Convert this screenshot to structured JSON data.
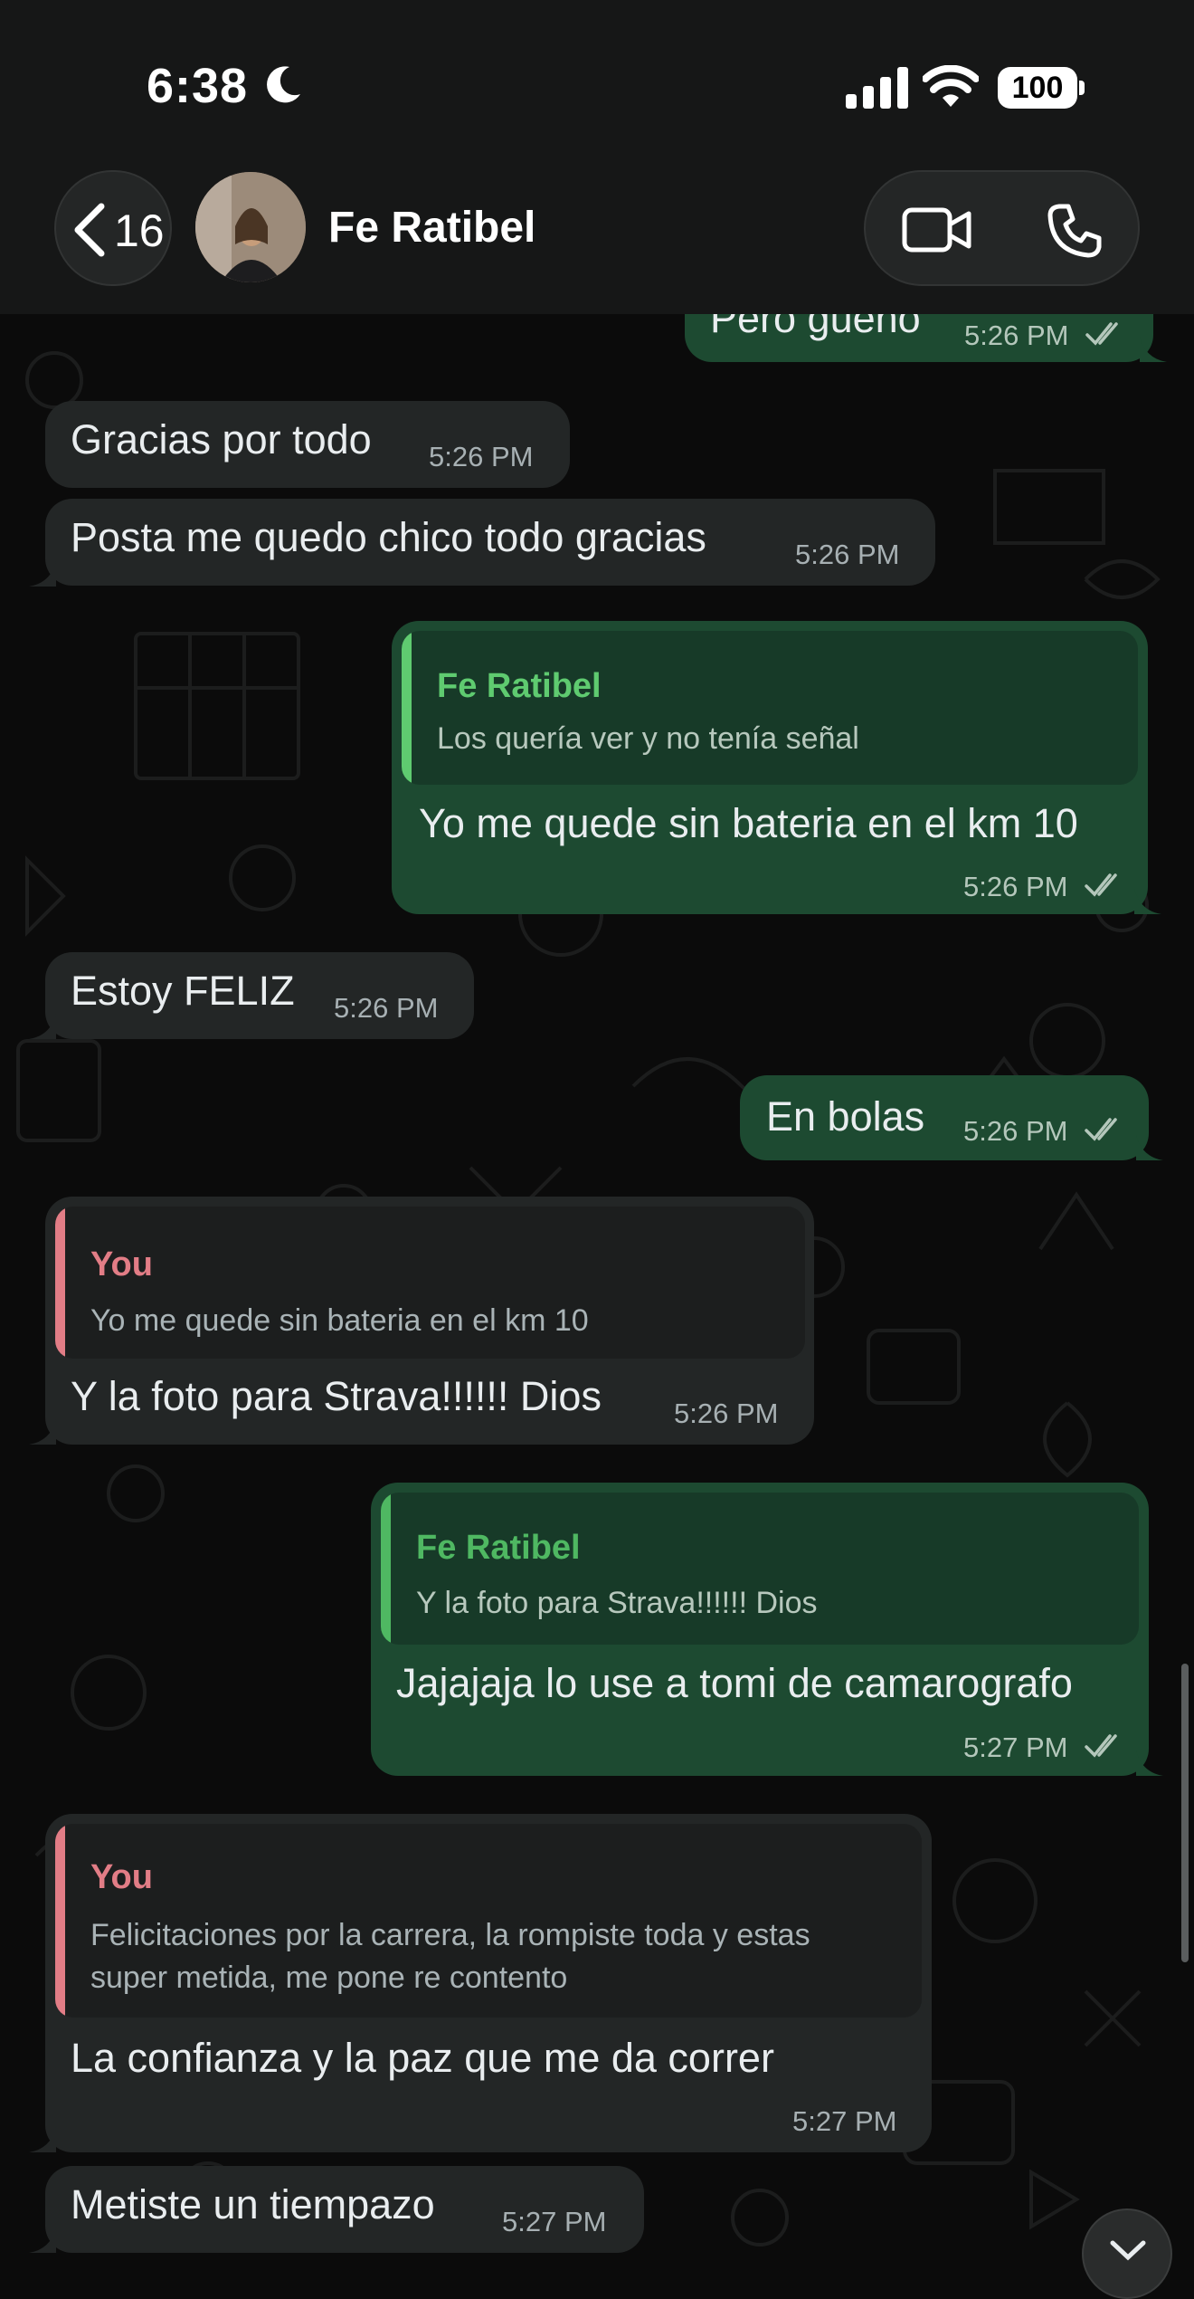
{
  "status_bar": {
    "time": "6:38",
    "battery": "100",
    "moon_icon": "moon-icon",
    "signal_icon": "cellular-signal-icon",
    "wifi_icon": "wifi-icon"
  },
  "header": {
    "back_count": "16",
    "contact_name": "Fe Ratibel",
    "video_icon": "video-camera-icon",
    "phone_icon": "phone-icon"
  },
  "colors": {
    "outgoing_bubble": "#1d4a31",
    "incoming_bubble": "#232626",
    "quote_green": "#5fcb70",
    "quote_pink": "#e27d86"
  },
  "messages": [
    {
      "direction": "out",
      "text": "Pero gueno",
      "time": "5:26 PM",
      "read": true
    },
    {
      "direction": "in",
      "text": "Gracias por todo",
      "time": "5:26 PM"
    },
    {
      "direction": "in",
      "text": "Posta me quedo chico todo gracias",
      "time": "5:26 PM"
    },
    {
      "direction": "out",
      "quote_name": "Fe Ratibel",
      "quote_text": "Los quería ver y no tenía señal",
      "text": "Yo me quede sin bateria en el km 10",
      "time": "5:26 PM",
      "read": true
    },
    {
      "direction": "in",
      "text": "Estoy FELIZ",
      "time": "5:26 PM"
    },
    {
      "direction": "out",
      "text": "En bolas",
      "time": "5:26 PM",
      "read": true
    },
    {
      "direction": "in",
      "quote_name": "You",
      "quote_text": "Yo me quede sin bateria en el km 10",
      "text": "Y la foto para Strava!!!!!! Dios",
      "time": "5:26 PM"
    },
    {
      "direction": "out",
      "quote_name": "Fe Ratibel",
      "quote_text": "Y la foto para Strava!!!!!! Dios",
      "text": "Jajajaja lo use a tomi de camarografo",
      "time": "5:27 PM",
      "read": true
    },
    {
      "direction": "in",
      "quote_name": "You",
      "quote_text_line1": "Felicitaciones por la carrera, la rompiste toda y estas",
      "quote_text_line2": "super metida, me pone re contento",
      "text": "La confianza y la paz que me da correr",
      "time": "5:27 PM"
    },
    {
      "direction": "in",
      "text": "Metiste un tiempazo",
      "time": "5:27 PM"
    }
  ],
  "scroll_down_icon": "chevron-down-icon"
}
